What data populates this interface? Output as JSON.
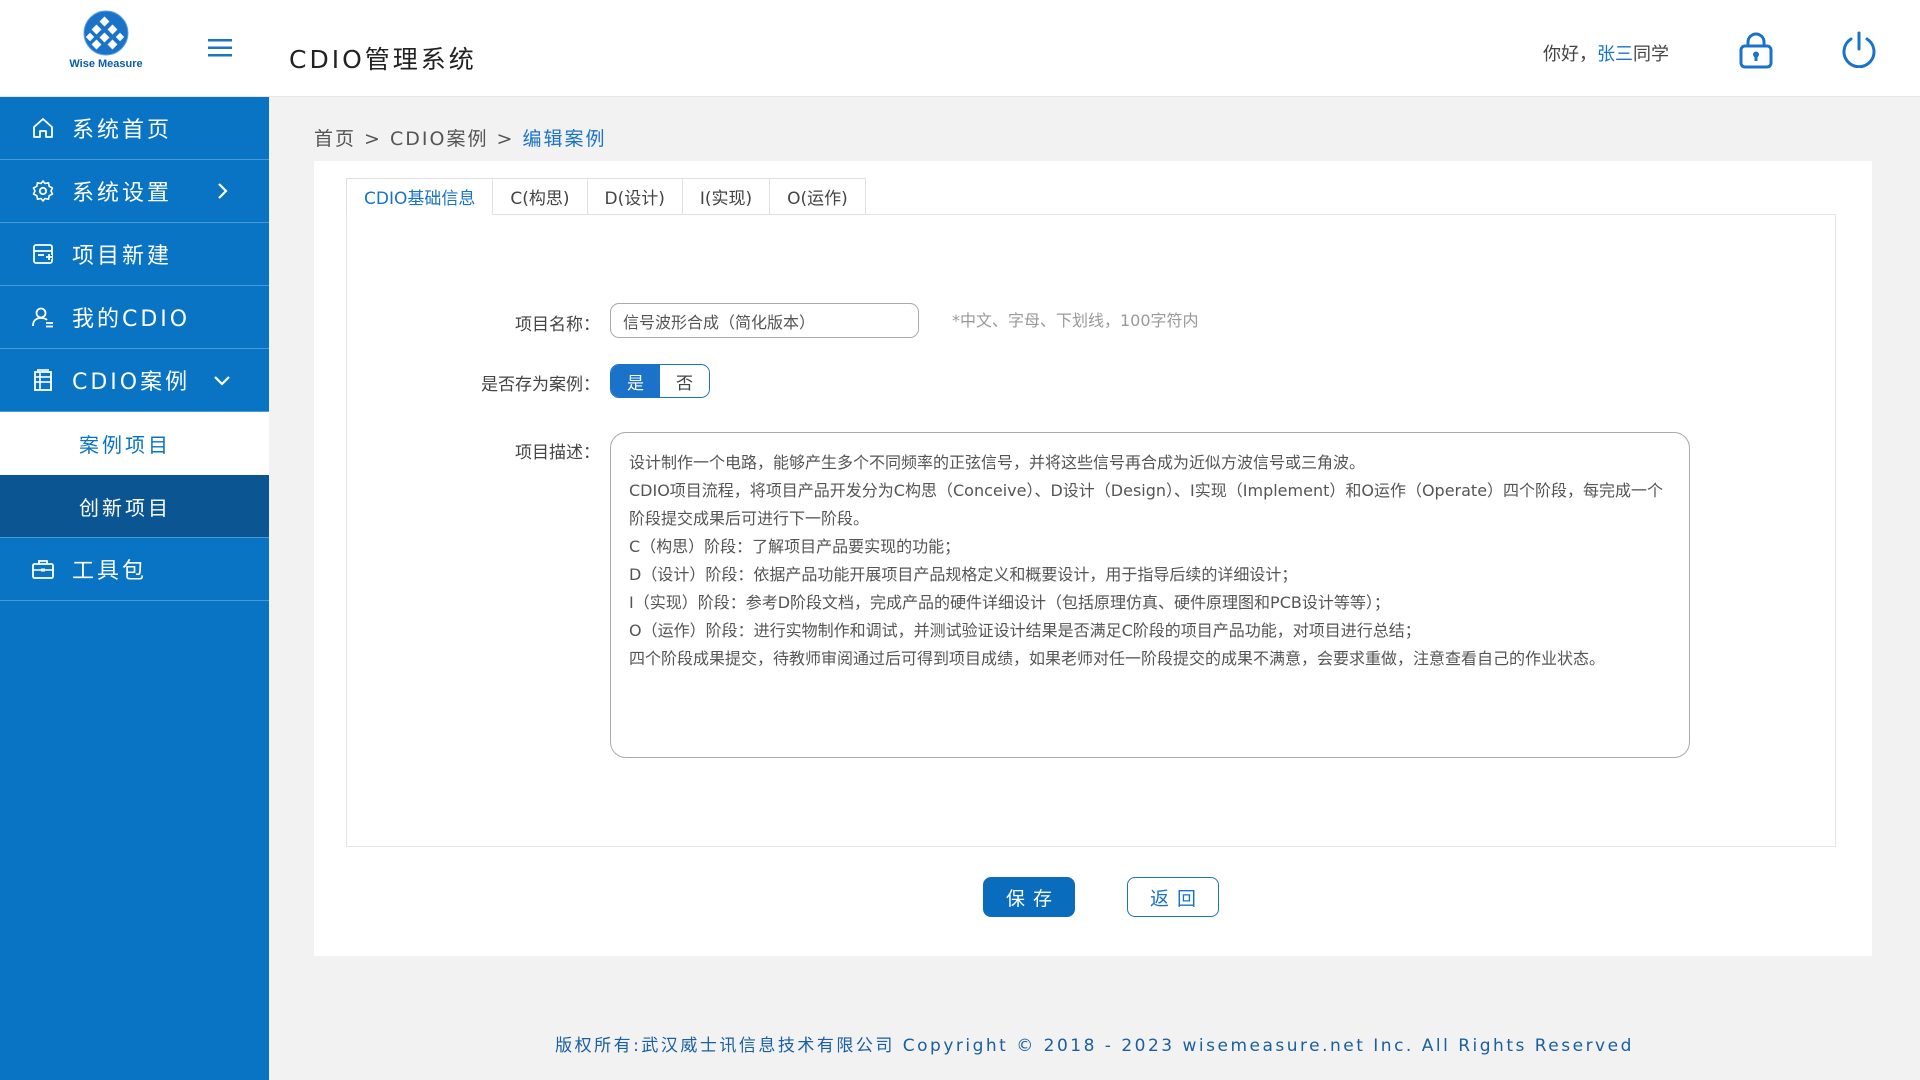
{
  "header": {
    "logo_text": "Wise Measure",
    "app_title": "CDIO管理系统",
    "greeting_prefix": "你好，",
    "user_name": "张三",
    "greeting_suffix": "同学",
    "lock_icon": "lock-icon",
    "power_icon": "power-icon"
  },
  "sidebar": {
    "items": [
      {
        "label": "系统首页",
        "icon": "home-icon"
      },
      {
        "label": "系统设置",
        "icon": "gear-icon"
      },
      {
        "label": "项目新建",
        "icon": "new-project-icon"
      },
      {
        "label": "我的CDIO",
        "icon": "user-icon"
      },
      {
        "label": "CDIO案例",
        "icon": "case-icon"
      }
    ],
    "sub_items": [
      {
        "label": "案例项目"
      },
      {
        "label": "创新项目"
      }
    ],
    "toolbox": {
      "label": "工具包",
      "icon": "briefcase-icon"
    }
  },
  "breadcrumb": {
    "home": "首页",
    "sep1": " > ",
    "section": "CDIO案例",
    "sep2": " > ",
    "current": "编辑案例"
  },
  "tabs": [
    "CDIO基础信息",
    "C(构思)",
    "D(设计)",
    "I(实现)",
    "O(运作)"
  ],
  "form": {
    "name_label": "项目名称：",
    "name_value": "信号波形合成（简化版本）",
    "name_hint": "*中文、字母、下划线，100字符内",
    "case_label": "是否存为案例：",
    "case_yes": "是",
    "case_no": "否",
    "desc_label": "项目描述：",
    "desc_value": "设计制作一个电路，能够产生多个不同频率的正弦信号，并将这些信号再合成为近似方波信号或三角波。\nCDIO项目流程，将项目产品开发分为C构思（Conceive）、D设计（Design）、I实现（Implement）和O运作（Operate）四个阶段，每完成一个阶段提交成果后可进行下一阶段。\nC（构思）阶段：了解项目产品要实现的功能；\nD（设计）阶段：依据产品功能开展项目产品规格定义和概要设计，用于指导后续的详细设计；\nI（实现）阶段：参考D阶段文档，完成产品的硬件详细设计（包括原理仿真、硬件原理图和PCB设计等等）；\nO（运作）阶段：进行实物制作和调试，并测试验证设计结果是否满足C阶段的项目产品功能，对项目进行总结；\n四个阶段成果提交，待教师审阅通过后可得到项目成绩，如果老师对任一阶段提交的成果不满意，会要求重做，注意查看自己的作业状态。"
  },
  "buttons": {
    "save": "保存",
    "back": "返回"
  },
  "footer": {
    "text": "版权所有:武汉威士讯信息技术有限公司 Copyright © 2018 - 2023 wisemeasure.net Inc. All Rights Reserved"
  },
  "colors": {
    "primary": "#0a74c4",
    "accent": "#1a73c9",
    "dark_nav": "#0a5592"
  }
}
